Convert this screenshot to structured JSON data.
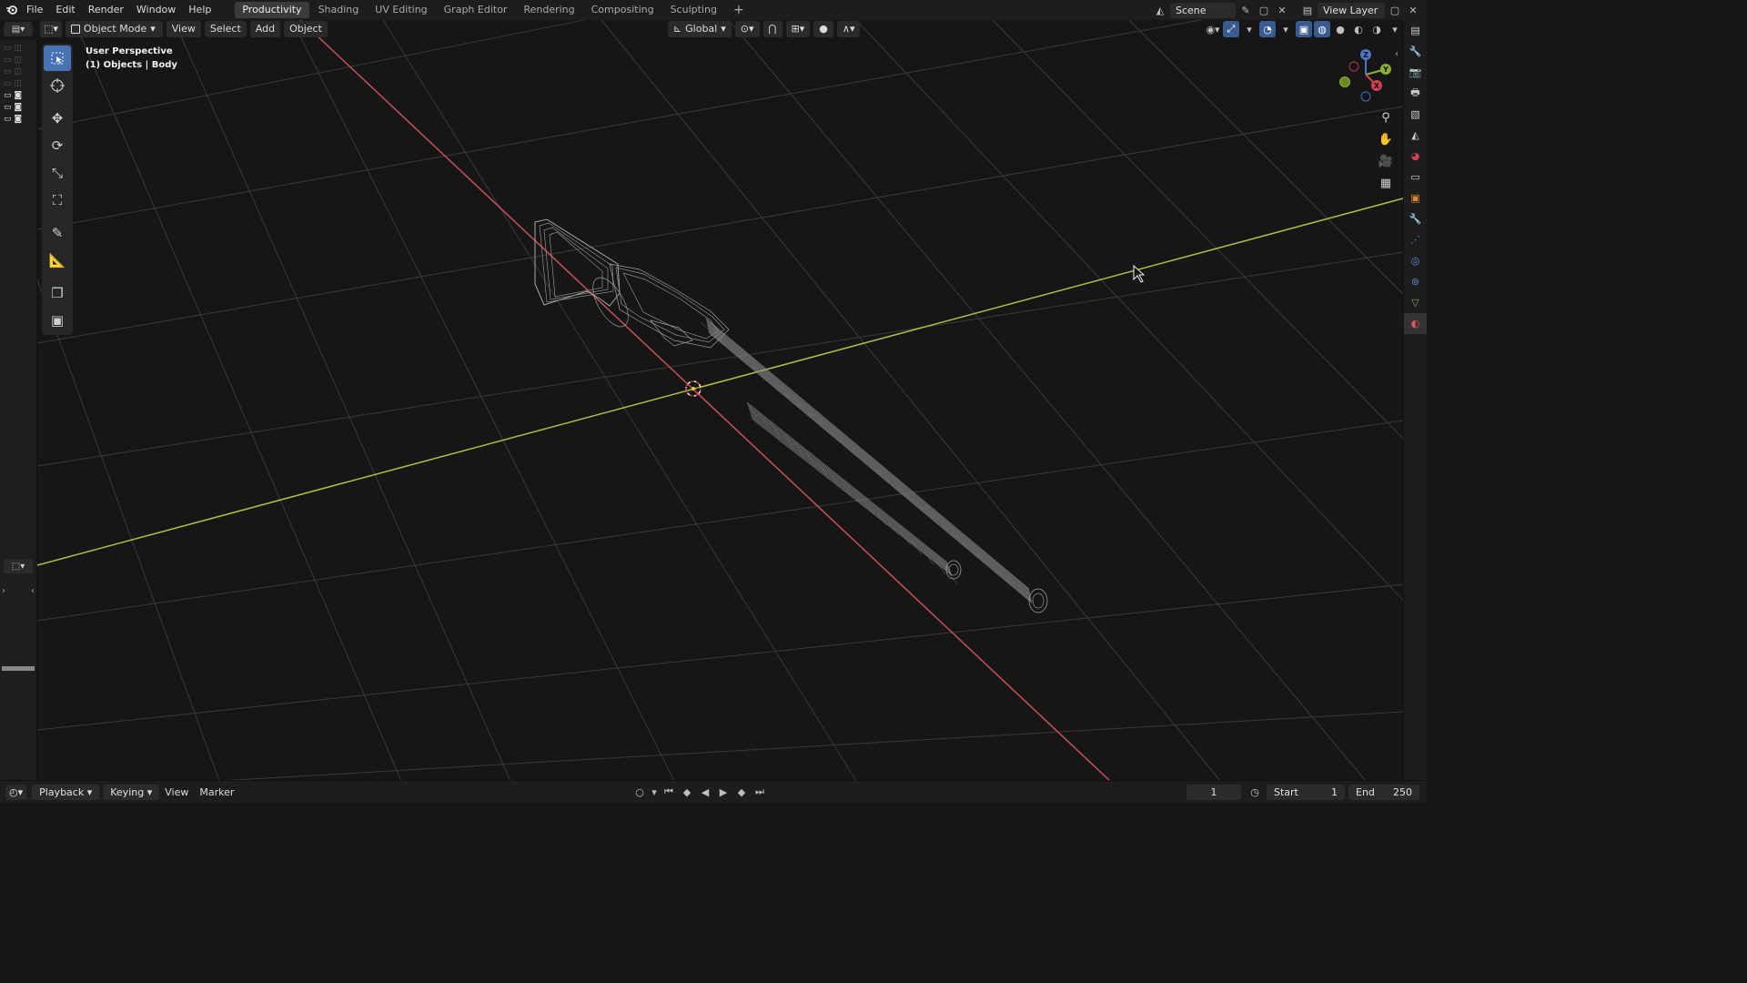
{
  "topbar": {
    "menus": [
      "File",
      "Edit",
      "Render",
      "Window",
      "Help"
    ],
    "workspaces": [
      "Productivity",
      "Shading",
      "UV Editing",
      "Graph Editor",
      "Rendering",
      "Compositing",
      "Sculpting"
    ],
    "active_workspace": "Productivity",
    "add_tab": "+",
    "scene": "Scene",
    "view_layer": "View Layer"
  },
  "header3d": {
    "mode": "Object Mode",
    "menus": [
      "View",
      "Select",
      "Add",
      "Object"
    ],
    "transform_orientation": "Global"
  },
  "viewport": {
    "perspective_label": "User Perspective",
    "objects_label": "(1) Objects | Body",
    "axis_x_color": "#c8505b",
    "axis_y_color": "#a9c441",
    "grid_color": "#3a3a3a",
    "background": "#161616"
  },
  "gizmo": {
    "x": "X",
    "y": "Y",
    "z": "Z"
  },
  "toolbar": {
    "tools": [
      "select-box-icon",
      "cursor-icon",
      "move-icon",
      "rotate-icon",
      "scale-icon",
      "transform-icon",
      "annotate-icon",
      "measure-icon",
      "add-cube-icon",
      "add-cube-alt-icon"
    ]
  },
  "timeline": {
    "menus": [
      "Playback",
      "Keying",
      "View",
      "Marker"
    ],
    "current_frame": "1",
    "start_label": "Start",
    "start_value": "1",
    "end_label": "End",
    "end_value": "250"
  },
  "accent_color": "#4772b3"
}
